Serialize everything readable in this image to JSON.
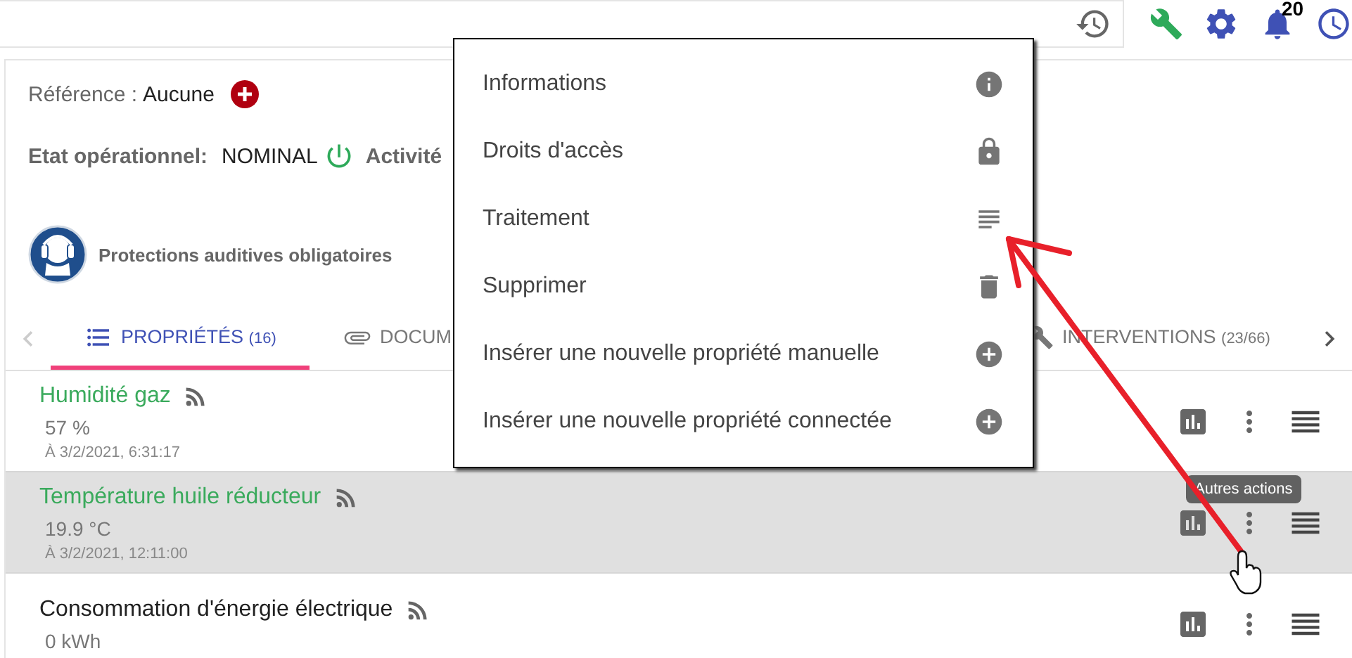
{
  "top_bar": {
    "notification_count": "20"
  },
  "card": {
    "reference_label": "Référence :",
    "reference_value": "Aucune",
    "state_label": "Etat opérationnel:",
    "state_value": "NOMINAL",
    "activity_label": "Activité",
    "safety_sign": "Protections auditives obligatoires"
  },
  "tabs": [
    {
      "kind": "list",
      "label": "PROPRIÉTÉS",
      "count": "(16)",
      "selected": true
    },
    {
      "kind": "attachment",
      "label": "DOCUM",
      "selected": false
    },
    {
      "kind": "tools",
      "label": "INTERVENTIONS",
      "count": "(23/66)",
      "selected": false
    }
  ],
  "properties": [
    {
      "name": "Humidité gaz",
      "color": "#3aaa5c",
      "value": "57 %",
      "time": "À 3/2/2021, 6:31:17",
      "highlighted": false
    },
    {
      "name": "Température huile réducteur",
      "color": "#3aaa5c",
      "value": "19.9 °C",
      "time": "À 3/2/2021, 12:11:00",
      "highlighted": true
    },
    {
      "name": "Consommation d'énergie électrique",
      "color": "#212121",
      "value": "0 kWh",
      "highlighted": false
    }
  ],
  "menu": [
    {
      "label": "Informations",
      "kind": "info"
    },
    {
      "label": "Droits d'accès",
      "kind": "access"
    },
    {
      "label": "Traitement",
      "kind": "process"
    },
    {
      "label": "Supprimer",
      "kind": "delete"
    },
    {
      "label": "Insérer une nouvelle propriété manuelle",
      "kind": "insert"
    },
    {
      "label": "Insérer une nouvelle propriété connectée",
      "kind": "insert"
    }
  ],
  "tooltip": "Autres actions"
}
